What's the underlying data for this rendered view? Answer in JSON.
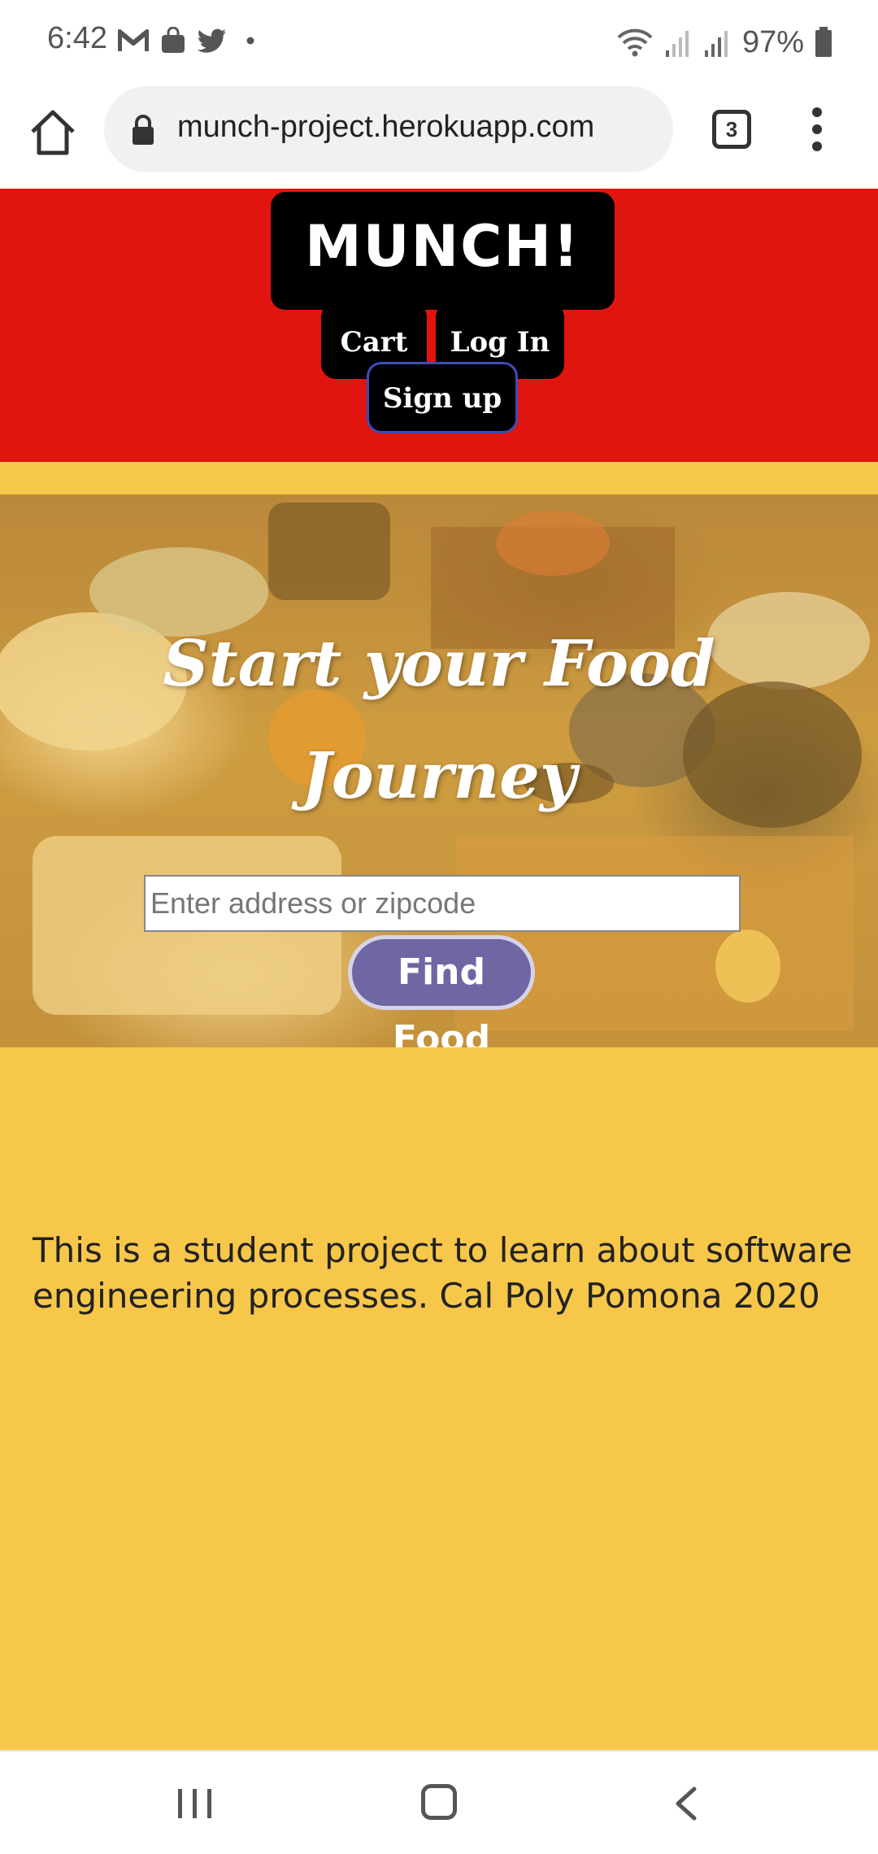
{
  "status_bar": {
    "time": "6:42",
    "battery": "97%",
    "notification_icons": [
      "gmail-icon",
      "shopping-bag-icon",
      "twitter-icon",
      "dot-icon"
    ],
    "system_icons": [
      "wifi-icon",
      "signal-icon",
      "signal-icon",
      "battery-icon"
    ]
  },
  "browser": {
    "url": "munch-project.herokuapp.com",
    "tab_count": "3"
  },
  "header": {
    "logo": "MUNCH!",
    "nav": {
      "cart": "Cart",
      "login": "Log In",
      "signup": "Sign up"
    }
  },
  "hero": {
    "title": "Start your Food Journey",
    "address_placeholder": "Enter address or zipcode",
    "address_value": "",
    "find_button": "Find Food"
  },
  "footer": {
    "note": "This is a student project to learn about software engineering processes. Cal Poly Pomona 2020"
  },
  "colors": {
    "header_red": "#e0150f",
    "page_yellow": "#f7c74a",
    "button_purple": "#6e67a4"
  }
}
